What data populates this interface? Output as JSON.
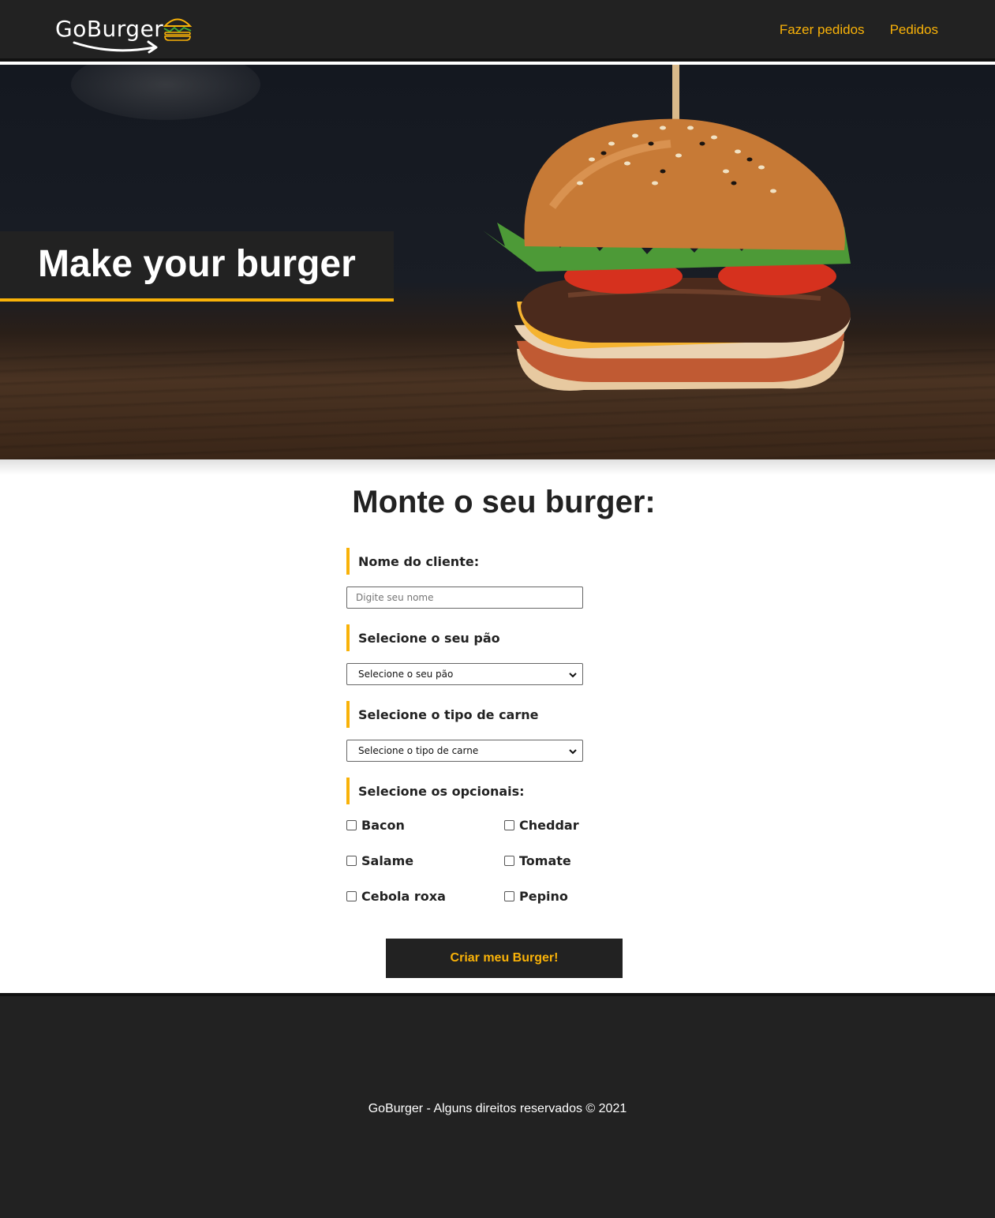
{
  "nav": {
    "logo_text": "GoBurger",
    "links": [
      "Fazer pedidos",
      "Pedidos"
    ],
    "accent_color": "#f9b208",
    "background_color": "#222222"
  },
  "hero": {
    "title": "Make your burger"
  },
  "form": {
    "heading": "Monte o seu burger:",
    "name_label": "Nome do cliente:",
    "name_placeholder": "Digite seu nome",
    "name_value": "",
    "bread_label": "Selecione o seu pão",
    "bread_selected": "Selecione o seu pão",
    "meat_label": "Selecione o tipo de carne",
    "meat_selected": "Selecione o tipo de carne",
    "options_label": "Selecione os opcionais:",
    "options": [
      {
        "label": "Bacon",
        "checked": false
      },
      {
        "label": "Cheddar",
        "checked": false
      },
      {
        "label": "Salame",
        "checked": false
      },
      {
        "label": "Tomate",
        "checked": false
      },
      {
        "label": "Cebola roxa",
        "checked": false
      },
      {
        "label": "Pepino",
        "checked": false
      }
    ],
    "submit_label": "Criar meu Burger!"
  },
  "footer": {
    "text": "GoBurger - Alguns direitos reservados © 2021"
  },
  "icons": {
    "logo_burger": "burger-icon",
    "logo_arrow": "swoosh-arrow-icon",
    "select_chevron": "chevron-down-icon",
    "checkbox": "checkbox-icon"
  }
}
